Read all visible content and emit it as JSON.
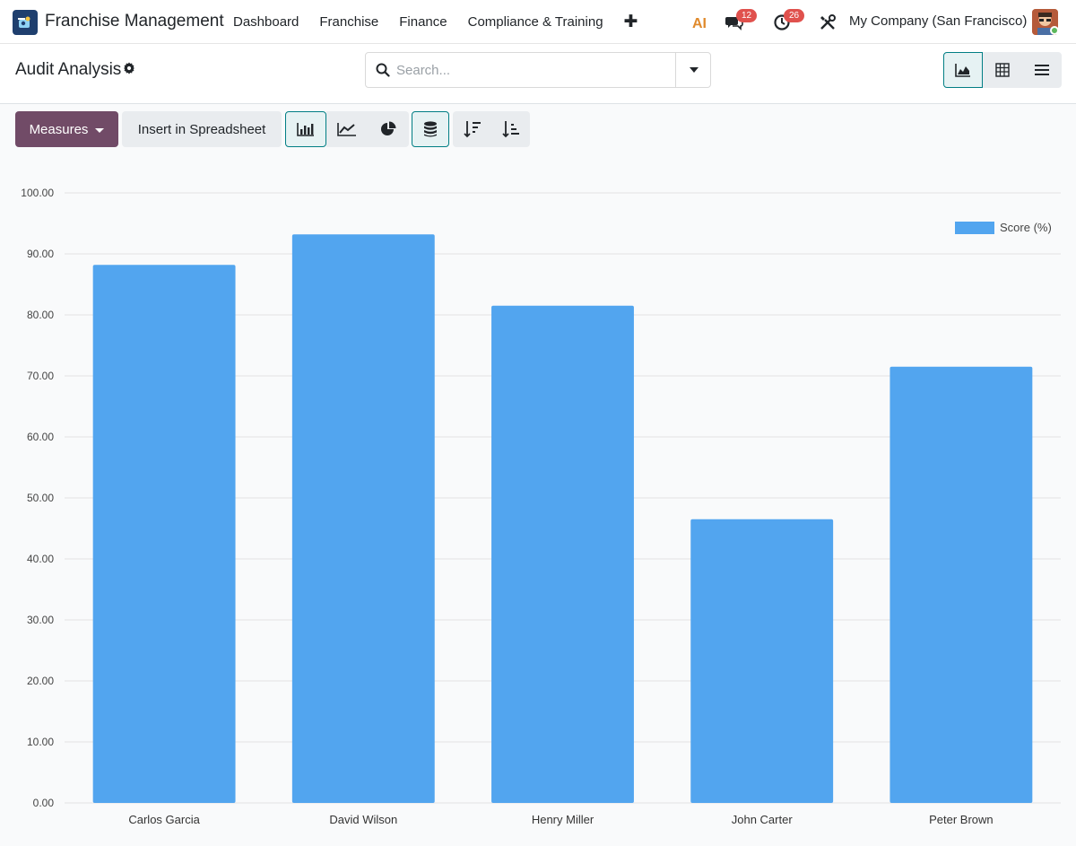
{
  "navbar": {
    "app_name": "Franchise Management",
    "menu": [
      "Dashboard",
      "Franchise",
      "Finance",
      "Compliance & Training"
    ],
    "add_symbol": "✚",
    "ai_label": "AI",
    "messages_count": "12",
    "activities_count": "26",
    "company": "My Company (San Francisco)"
  },
  "control_panel": {
    "title": "Audit Analysis",
    "search_placeholder": "Search..."
  },
  "toolbar": {
    "measures_label": "Measures",
    "insert_label": "Insert in Spreadsheet"
  },
  "colors": {
    "brand": "#714b67",
    "accent": "#017e84",
    "bar": "#52a5ef",
    "badge": "#e0514d"
  },
  "chart_data": {
    "type": "bar",
    "categories": [
      "Carlos Garcia",
      "David Wilson",
      "Henry Miller",
      "John Carter",
      "Peter Brown"
    ],
    "series": [
      {
        "name": "Score (%)",
        "values": [
          88.2,
          93.2,
          81.5,
          46.5,
          71.5
        ]
      }
    ],
    "ylim": [
      0,
      100
    ],
    "yticks": [
      "0.00",
      "10.00",
      "20.00",
      "30.00",
      "40.00",
      "50.00",
      "60.00",
      "70.00",
      "80.00",
      "90.00",
      "100.00"
    ],
    "grid": true,
    "legend_position": "top-right"
  }
}
